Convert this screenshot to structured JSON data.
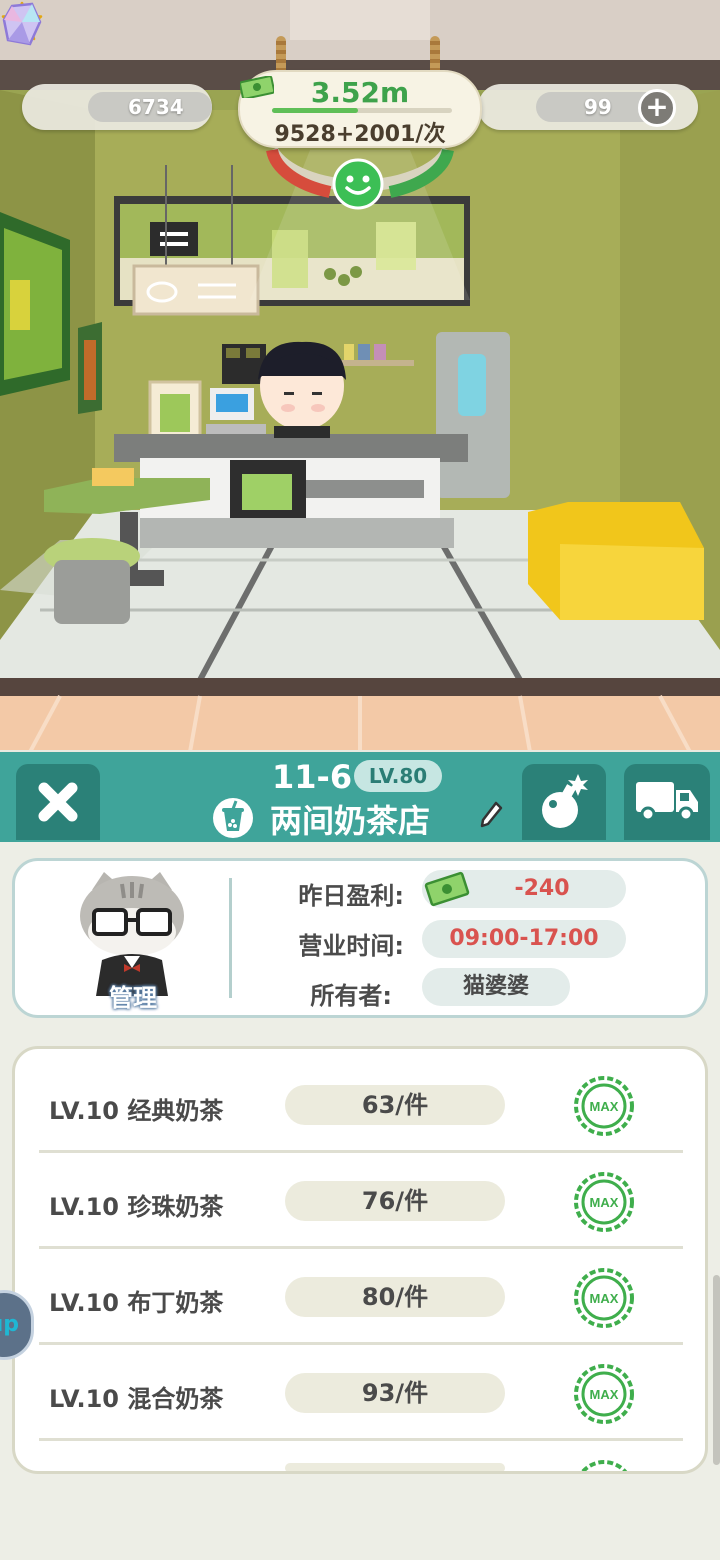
{
  "hud": {
    "stars": "6734",
    "gems": "99",
    "money": "3.52m",
    "rate": "9528+2001/次",
    "money_progress": 0.48
  },
  "panel": {
    "level_code": "11-6",
    "level_badge": "LV.80",
    "shop_name": "两间奶茶店",
    "manager_tag": "管理"
  },
  "info": {
    "profit_label": "昨日盈利:",
    "profit_value": "-240",
    "hours_label": "营业时间:",
    "hours_value": "09:00-17:00",
    "owner_label": "所有者:",
    "owner_value": "猫婆婆"
  },
  "products": [
    {
      "name": "LV.10  经典奶茶",
      "price": "63/件",
      "status": "MAX"
    },
    {
      "name": "LV.10  珍珠奶茶",
      "price": "76/件",
      "status": "MAX"
    },
    {
      "name": "LV.10  布丁奶茶",
      "price": "80/件",
      "status": "MAX"
    },
    {
      "name": "LV.10  混合奶茶",
      "price": "93/件",
      "status": "MAX"
    }
  ],
  "side_tab": "up",
  "colors": {
    "header_teal": "#3fa49a",
    "profit_red": "#d9534f",
    "money_green": "#3ea24b"
  }
}
